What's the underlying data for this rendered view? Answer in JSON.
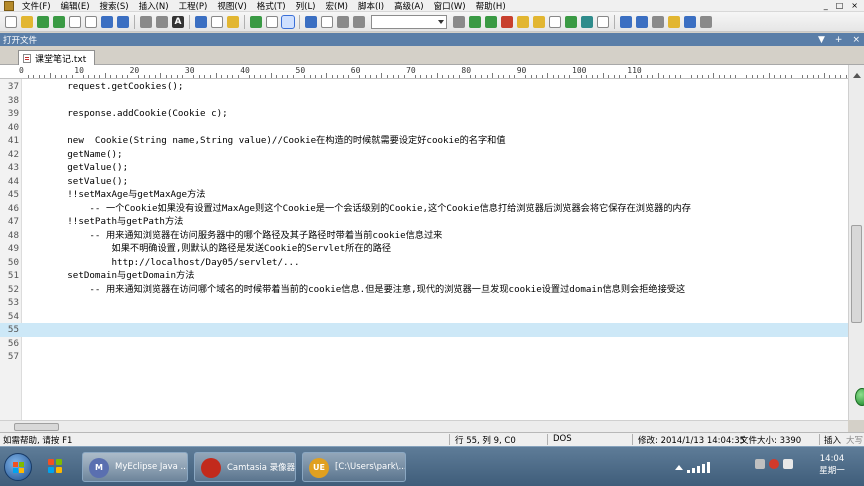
{
  "menu": [
    "文件(F)",
    "编辑(E)",
    "搜索(S)",
    "插入(N)",
    "工程(P)",
    "视图(V)",
    "格式(T)",
    "列(L)",
    "宏(M)",
    "脚本(I)",
    "高级(A)",
    "窗口(W)",
    "帮助(H)"
  ],
  "window_controls": [
    "_",
    "□",
    "×"
  ],
  "file_panel": {
    "title": "打开文件",
    "controls": [
      "▼",
      "+",
      "×"
    ]
  },
  "tab": {
    "label": "课堂笔记.txt"
  },
  "ruler": {
    "labels": [
      "0",
      "10",
      "20",
      "30",
      "40",
      "50",
      "60",
      "70",
      "80",
      "90",
      "100",
      "110"
    ]
  },
  "lines": [
    {
      "n": "37",
      "text": "        request.getCookies();"
    },
    {
      "n": "38",
      "text": ""
    },
    {
      "n": "39",
      "text": "        response.addCookie(Cookie c);"
    },
    {
      "n": "40",
      "text": ""
    },
    {
      "n": "41",
      "text": "        new  Cookie(String name,String value)//Cookie在构造的时候就需要设定好cookie的名字和值"
    },
    {
      "n": "42",
      "text": "        getName();"
    },
    {
      "n": "43",
      "text": "        getValue();"
    },
    {
      "n": "44",
      "text": "        setValue();"
    },
    {
      "n": "45",
      "text": "        !!setMaxAge与getMaxAge方法"
    },
    {
      "n": "46",
      "text": "            -- 一个Cookie如果没有设置过MaxAge则这个Cookie是一个会话级别的Cookie,这个Cookie信息打给浏览器后浏览器会将它保存在浏览器的内存"
    },
    {
      "n": "47",
      "text": "        !!setPath与getPath方法"
    },
    {
      "n": "48",
      "text": "            -- 用来通知浏览器在访问服务器中的哪个路径及其子路径时带着当前cookie信息过来"
    },
    {
      "n": "49",
      "text": "                如果不明确设置,则默认的路径是发送Cookie的Servlet所在的路径"
    },
    {
      "n": "50",
      "text": "                http://localhost/Day05/servlet/..."
    },
    {
      "n": "51",
      "text": "        setDomain与getDomain方法"
    },
    {
      "n": "52",
      "text": "            -- 用来通知浏览器在访问哪个域名的时候带着当前的cookie信息.但是要注意,现代的浏览器一旦发现cookie设置过domain信息则会拒绝接受这"
    },
    {
      "n": "53",
      "text": ""
    },
    {
      "n": "54",
      "text": ""
    },
    {
      "n": "55",
      "text": ""
    },
    {
      "n": "56",
      "text": ""
    },
    {
      "n": "57",
      "text": ""
    }
  ],
  "current_line": "55",
  "status": {
    "help": "如需帮助, 请按 F1",
    "position": "行 55, 列 9, C0",
    "format": "DOS",
    "modified": "修改: 2014/1/13 14:04:35",
    "size": "文件大小: 3390",
    "mode": "插入",
    "caps": "大写"
  },
  "taskbar": {
    "apps": [
      {
        "label": "MyEclipse Java ...",
        "icon_color": "#5a6fb0",
        "icon": "M"
      },
      {
        "label": "Camtasia 录像器",
        "icon_color": "#c22a1c",
        "icon": ""
      },
      {
        "label": "[C:\\Users\\park\\...",
        "icon_color": "#e0a020",
        "icon": "UE"
      }
    ],
    "clock_time": "14:04",
    "clock_day": "星期一"
  },
  "colors": {
    "accent": "#5a7ea8",
    "current_line_bg": "#cde8f7",
    "taskbar": "#4a6885"
  }
}
